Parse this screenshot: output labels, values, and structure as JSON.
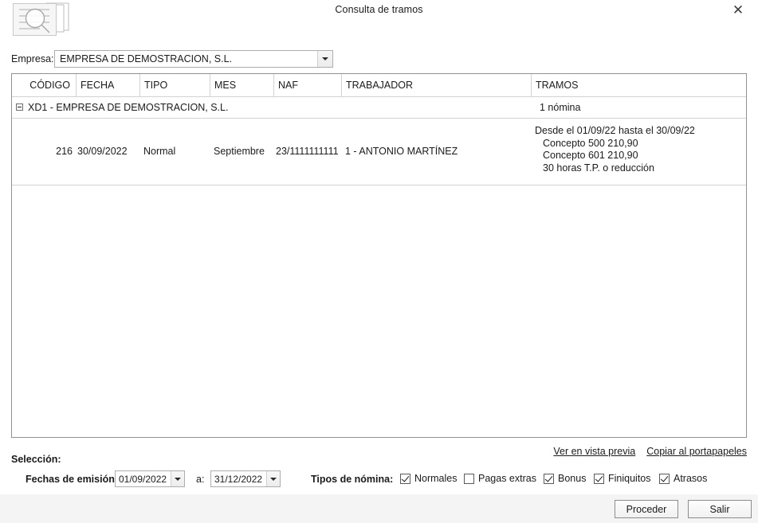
{
  "window": {
    "title": "Consulta de tramos",
    "close_label": "✕",
    "icon_name": "document-search-icon"
  },
  "empresa": {
    "label": "Empresa:",
    "value": "EMPRESA DE DEMOSTRACION, S.L."
  },
  "grid": {
    "columns": [
      {
        "key": "codigo",
        "label": "CÓDIGO",
        "align": "right"
      },
      {
        "key": "fecha",
        "label": "FECHA",
        "align": "left"
      },
      {
        "key": "tipo",
        "label": "TIPO",
        "align": "left"
      },
      {
        "key": "mes",
        "label": "MES",
        "align": "left"
      },
      {
        "key": "naf",
        "label": "NAF",
        "align": "left"
      },
      {
        "key": "trabajador",
        "label": "TRABAJADOR",
        "align": "left"
      },
      {
        "key": "tramos",
        "label": "TRAMOS",
        "align": "left"
      }
    ],
    "group": {
      "label": "XD1 - EMPRESA DE DEMOSTRACION, S.L.",
      "count": "1 nómina"
    },
    "row": {
      "codigo": "216",
      "fecha": "30/09/2022",
      "tipo": "Normal",
      "mes": "Septiembre",
      "naf": "23/1111111111",
      "trabajador": "1 - ANTONIO MARTÍNEZ",
      "tramos": [
        "Desde el 01/09/22 hasta el 30/09/22",
        "Concepto 500 210,90",
        "Concepto 601 210,90",
        "30 horas T.P. o reducción"
      ]
    }
  },
  "links": {
    "preview": "Ver en vista previa",
    "clipboard": "Copiar al portapapeles"
  },
  "selection": {
    "title": "Selección:",
    "dates_label": "Fechas de emisión:",
    "date_from": "01/09/2022",
    "to_label": "a:",
    "date_to": "31/12/2022",
    "types_label": "Tipos de nómina:",
    "types": [
      {
        "label": "Normales",
        "checked": true
      },
      {
        "label": "Pagas extras",
        "checked": false
      },
      {
        "label": "Bonus",
        "checked": true
      },
      {
        "label": "Finiquitos",
        "checked": true
      },
      {
        "label": "Atrasos",
        "checked": true
      }
    ]
  },
  "footer": {
    "proceed_label": "Proceder",
    "exit_label": "Salir"
  },
  "colors": {
    "background": "#ffffff",
    "footer": "#f4f4f4",
    "border": "#919191",
    "grid_line": "#d2d2d2",
    "text": "#1b1b1b"
  }
}
